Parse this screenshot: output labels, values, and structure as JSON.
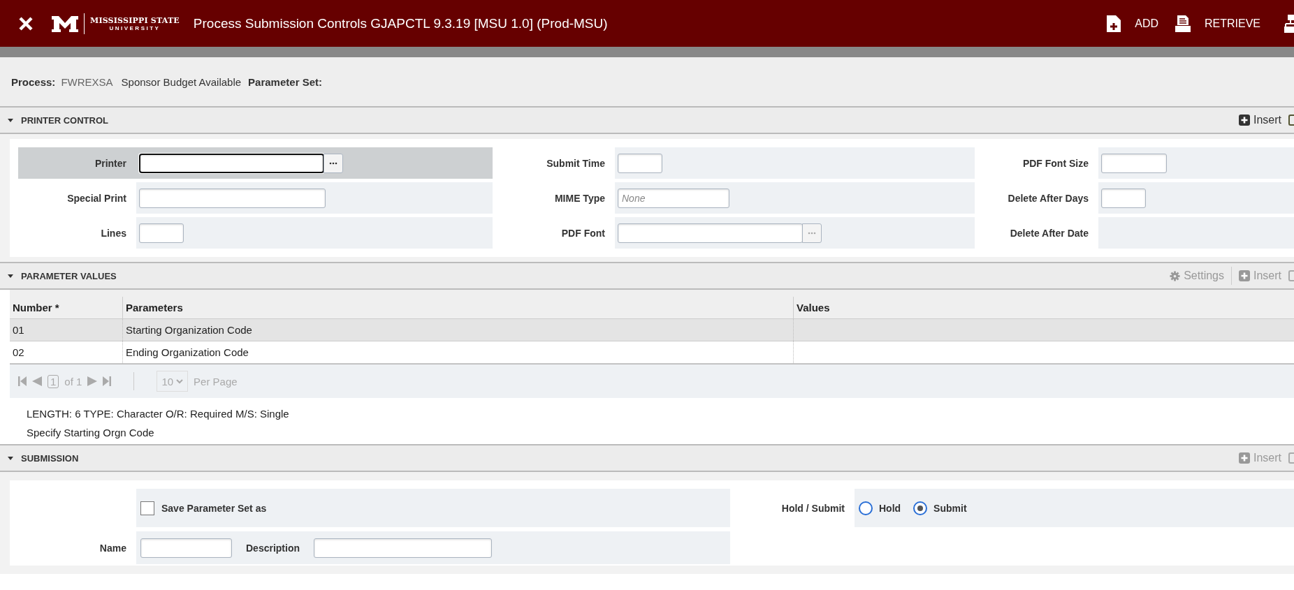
{
  "header": {
    "logo_line1": "MISSISSIPPI STATE",
    "logo_line2": "UNIVERSITY",
    "title": "Process Submission Controls GJAPCTL 9.3.19 [MSU 1.0] (Prod-MSU)",
    "actions": [
      {
        "kind": "add",
        "label": "ADD"
      },
      {
        "kind": "retrieve",
        "label": "RETRIEVE"
      },
      {
        "kind": "related"
      }
    ]
  },
  "process": {
    "label": "Process:",
    "code": "FWREXSA",
    "name": "Sponsor Budget Available",
    "parameter_set_label": "Parameter Set:"
  },
  "printer_control": {
    "title": "PRINTER CONTROL",
    "expanded": true,
    "insert": {
      "label": "Insert",
      "disabled": false
    },
    "rows": [
      [
        {
          "label": "Printer",
          "kind": "lookup",
          "focused": true,
          "disabled": false
        },
        {
          "label": "Submit Time",
          "kind": "short",
          "focused": false
        },
        {
          "label": "PDF Font Size",
          "kind": "compact",
          "focused": false
        }
      ],
      [
        {
          "label": "Special Print",
          "kind": "wide",
          "focused": false
        },
        {
          "label": "MIME Type",
          "kind": "medium",
          "placeholder": "None",
          "focused": false
        },
        {
          "label": "Delete After Days",
          "kind": "short",
          "focused": false
        }
      ],
      [
        {
          "label": "Lines",
          "kind": "short",
          "focused": false
        },
        {
          "label": "PDF Font",
          "kind": "lookup",
          "focused": false,
          "disabled": true
        },
        {
          "label": "Delete After Date",
          "kind": "none",
          "focused": false
        }
      ]
    ]
  },
  "parameter_values": {
    "title": "PARAMETER VALUES",
    "expanded": true,
    "settings": {
      "label": "Settings",
      "disabled": true
    },
    "insert": {
      "label": "Insert",
      "disabled": true
    },
    "columns": [
      "Number *",
      "Parameters",
      "Values"
    ],
    "rows": [
      {
        "number": "01",
        "parameter": "Starting Organization Code",
        "selected": true
      },
      {
        "number": "02",
        "parameter": "Ending Organization Code",
        "selected": false
      }
    ],
    "pager": {
      "page": "1",
      "of": "of 1",
      "per_page": "10",
      "per_page_label": "Per Page",
      "disabled": true
    },
    "help": [
      "LENGTH: 6 TYPE: Character O/R: Required M/S: Single",
      "Specify Starting Orgn Code"
    ]
  },
  "submission": {
    "title": "SUBMISSION",
    "expanded": true,
    "insert": {
      "label": "Insert",
      "disabled": true
    },
    "save_parameter_set": {
      "label": "Save Parameter Set as",
      "checked": false
    },
    "name_label": "Name",
    "description_label": "Description",
    "hold_submit": {
      "label": "Hold / Submit",
      "options": [
        {
          "label": "Hold",
          "selected": false
        },
        {
          "label": "Submit",
          "selected": true
        }
      ]
    }
  }
}
